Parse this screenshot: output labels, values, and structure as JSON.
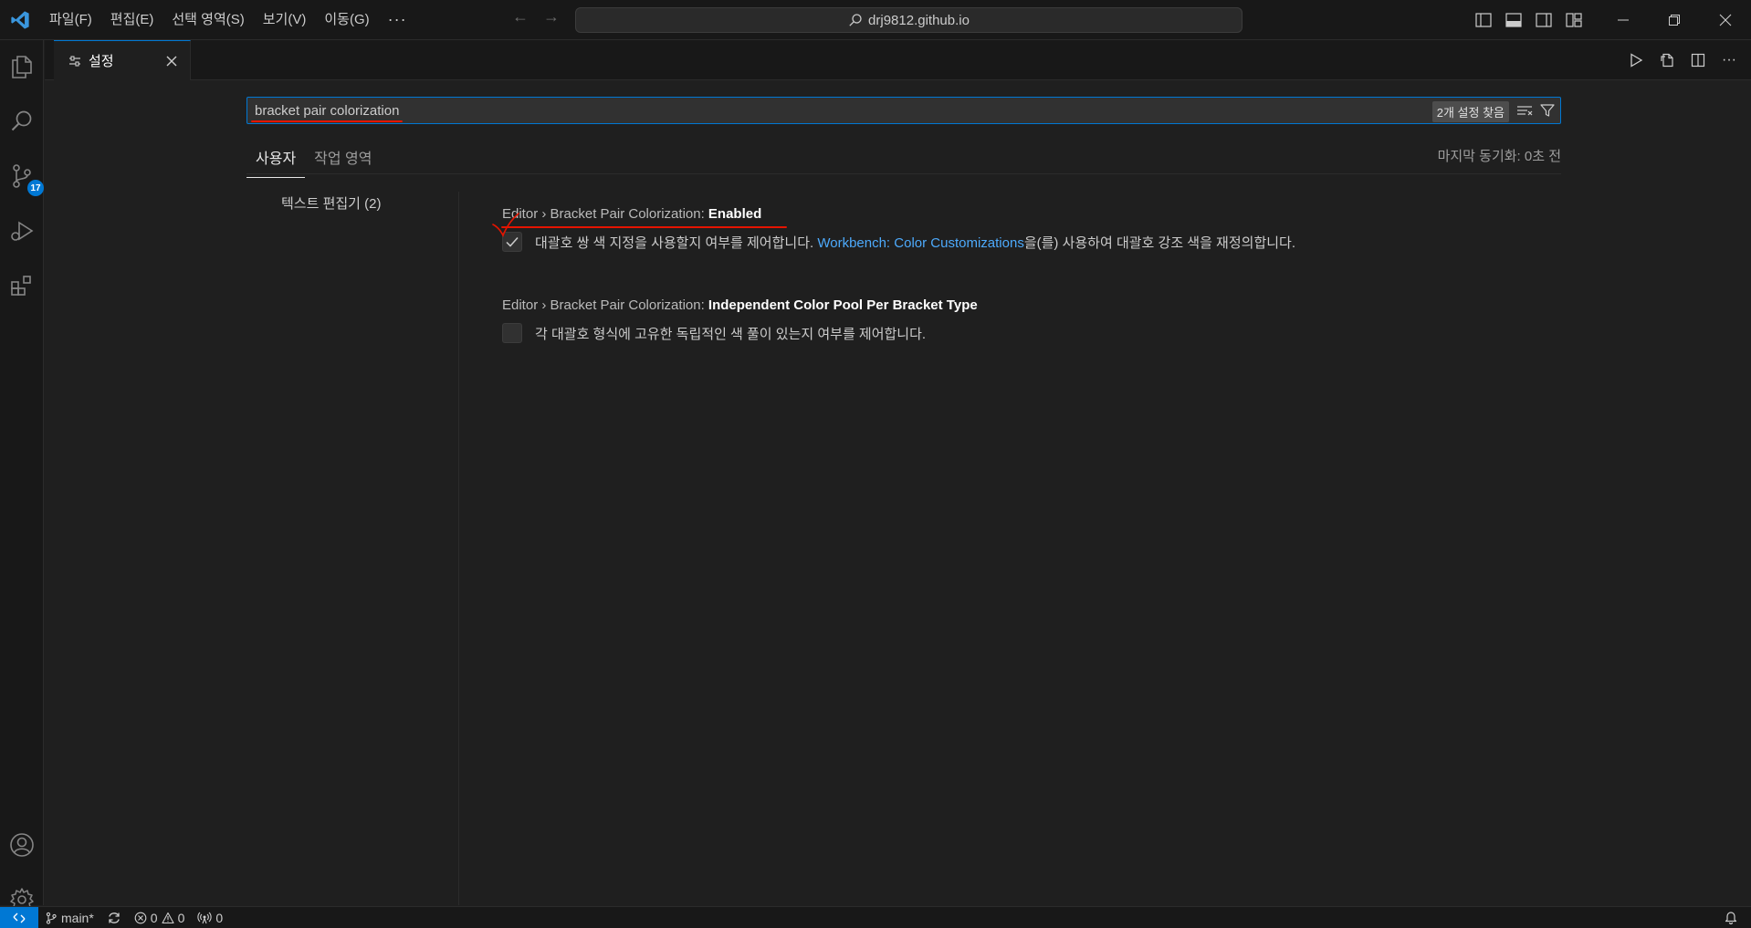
{
  "titlebar": {
    "menu": [
      "파일(F)",
      "편집(E)",
      "선택 영역(S)",
      "보기(V)",
      "이동(G)"
    ],
    "more": "···",
    "search": "drj9812.github.io"
  },
  "activitybar": {
    "source_control_badge": "17"
  },
  "tab": {
    "label": "설정"
  },
  "settings": {
    "search_query": "bracket pair colorization",
    "result_count": "2개 설정 찾음",
    "scope_tabs": [
      "사용자",
      "작업 영역"
    ],
    "sync_status": "마지막 동기화: 0초 전",
    "toc_item": "텍스트 편집기 (2)",
    "items": [
      {
        "category": "Editor › Bracket Pair Colorization: ",
        "key": "Enabled",
        "checked": true,
        "desc_before": "대괄호 쌍 색 지정을 사용할지 여부를 제어합니다. ",
        "desc_link": "Workbench: Color Customizations",
        "desc_after": "을(를) 사용하여 대괄호 강조 색을 재정의합니다."
      },
      {
        "category": "Editor › Bracket Pair Colorization: ",
        "key": "Independent Color Pool Per Bracket Type",
        "checked": false,
        "desc": "각 대괄호 형식에 고유한 독립적인 색 풀이 있는지 여부를 제어합니다."
      }
    ]
  },
  "statusbar": {
    "branch": "main*",
    "errors": "0",
    "warnings": "0",
    "ports": "0"
  },
  "colors": {
    "accent": "#0078d4",
    "annotation_red": "#e51400",
    "link": "#4daafc"
  }
}
